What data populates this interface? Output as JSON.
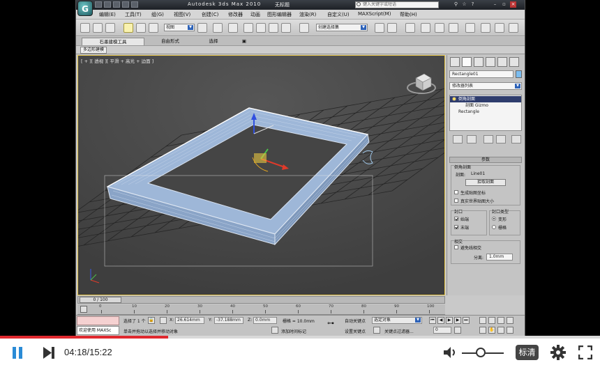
{
  "window": {
    "app_logo": "G",
    "title": "Autodesk 3ds Max  2010",
    "file_name": "无标题",
    "search_placeholder": "键入关键字或短语"
  },
  "menu": [
    "编辑(E)",
    "工具(T)",
    "组(G)",
    "视图(V)",
    "创建(C)",
    "修改器",
    "动画",
    "图形编辑器",
    "渲染(R)",
    "自定义(U)",
    "MAXScript(M)",
    "帮助(H)"
  ],
  "toolbar": {
    "filter_dropdown": "视图",
    "selection_set_dropdown": "创建选择集"
  },
  "ribbon": {
    "tabs": [
      "石墨建模工具",
      "自由形式",
      "选择",
      "▣"
    ],
    "active_tab": "石墨建模工具",
    "sub_label": "多边形建模"
  },
  "viewport": {
    "label": "[ + ][ 透视 ][ 平滑 + 高光 + 边面 ]"
  },
  "command_panel": {
    "object_name": "Rectangle01",
    "modifier_list": "修改器列表",
    "stack": [
      {
        "label": "倒角剖面",
        "selected": true
      },
      {
        "label": "剖面 Gizmo",
        "selected": false
      },
      {
        "label": "Rectangle",
        "selected": false
      }
    ],
    "rollout_title": "参数",
    "group_bevel_profile": "倒角剖面",
    "profile_label": "剖面:",
    "profile_value": "Line01",
    "pick_profile_button": "拾取剖面",
    "checkbox_generate_mapping": "生成贴图坐标",
    "checkbox_real_world": "真实世界贴图大小",
    "generate_mapping_checked": false,
    "real_world_checked": false,
    "group_caps": "封口",
    "cap_start": "始端",
    "cap_end": "末端",
    "cap_start_checked": true,
    "cap_end_checked": true,
    "group_cap_type": "封口类型",
    "cap_type_morph": "变形",
    "cap_type_grid": "栅格",
    "cap_type_selected": "变形",
    "group_intersections": "相交",
    "avoid_self_intersect": "避免线相交",
    "separation_label": "分离:",
    "separation_value": "1.0mm"
  },
  "timeline": {
    "frame_indicator": "0 / 100",
    "ticks": [
      "0",
      "10",
      "20",
      "30",
      "40",
      "50",
      "60",
      "70",
      "80",
      "90",
      "100"
    ]
  },
  "status": {
    "maxscript_label": "欢迎使用 MAXSc",
    "selected_text": "选择了 1 个",
    "x_label": "X:",
    "x_value": "26.614mm",
    "y_label": "Y:",
    "y_value": "-37.188mm",
    "z_label": "Z:",
    "z_value": "0.0mm",
    "grid_text": "栅格 = 10.0mm",
    "prompt_text": "单击并拖动以选择并移动对象",
    "add_time_tag": "添加时间标记",
    "auto_key": "自动关键点",
    "set_key": "设置关键点",
    "selected_object_dropdown": "选定对象",
    "key_filters": "关键点过滤器...",
    "frame_value": "0"
  },
  "player": {
    "time": "04:18/15:22",
    "quality_label": "标清",
    "progress": 0.28,
    "volume": 0.45
  }
}
